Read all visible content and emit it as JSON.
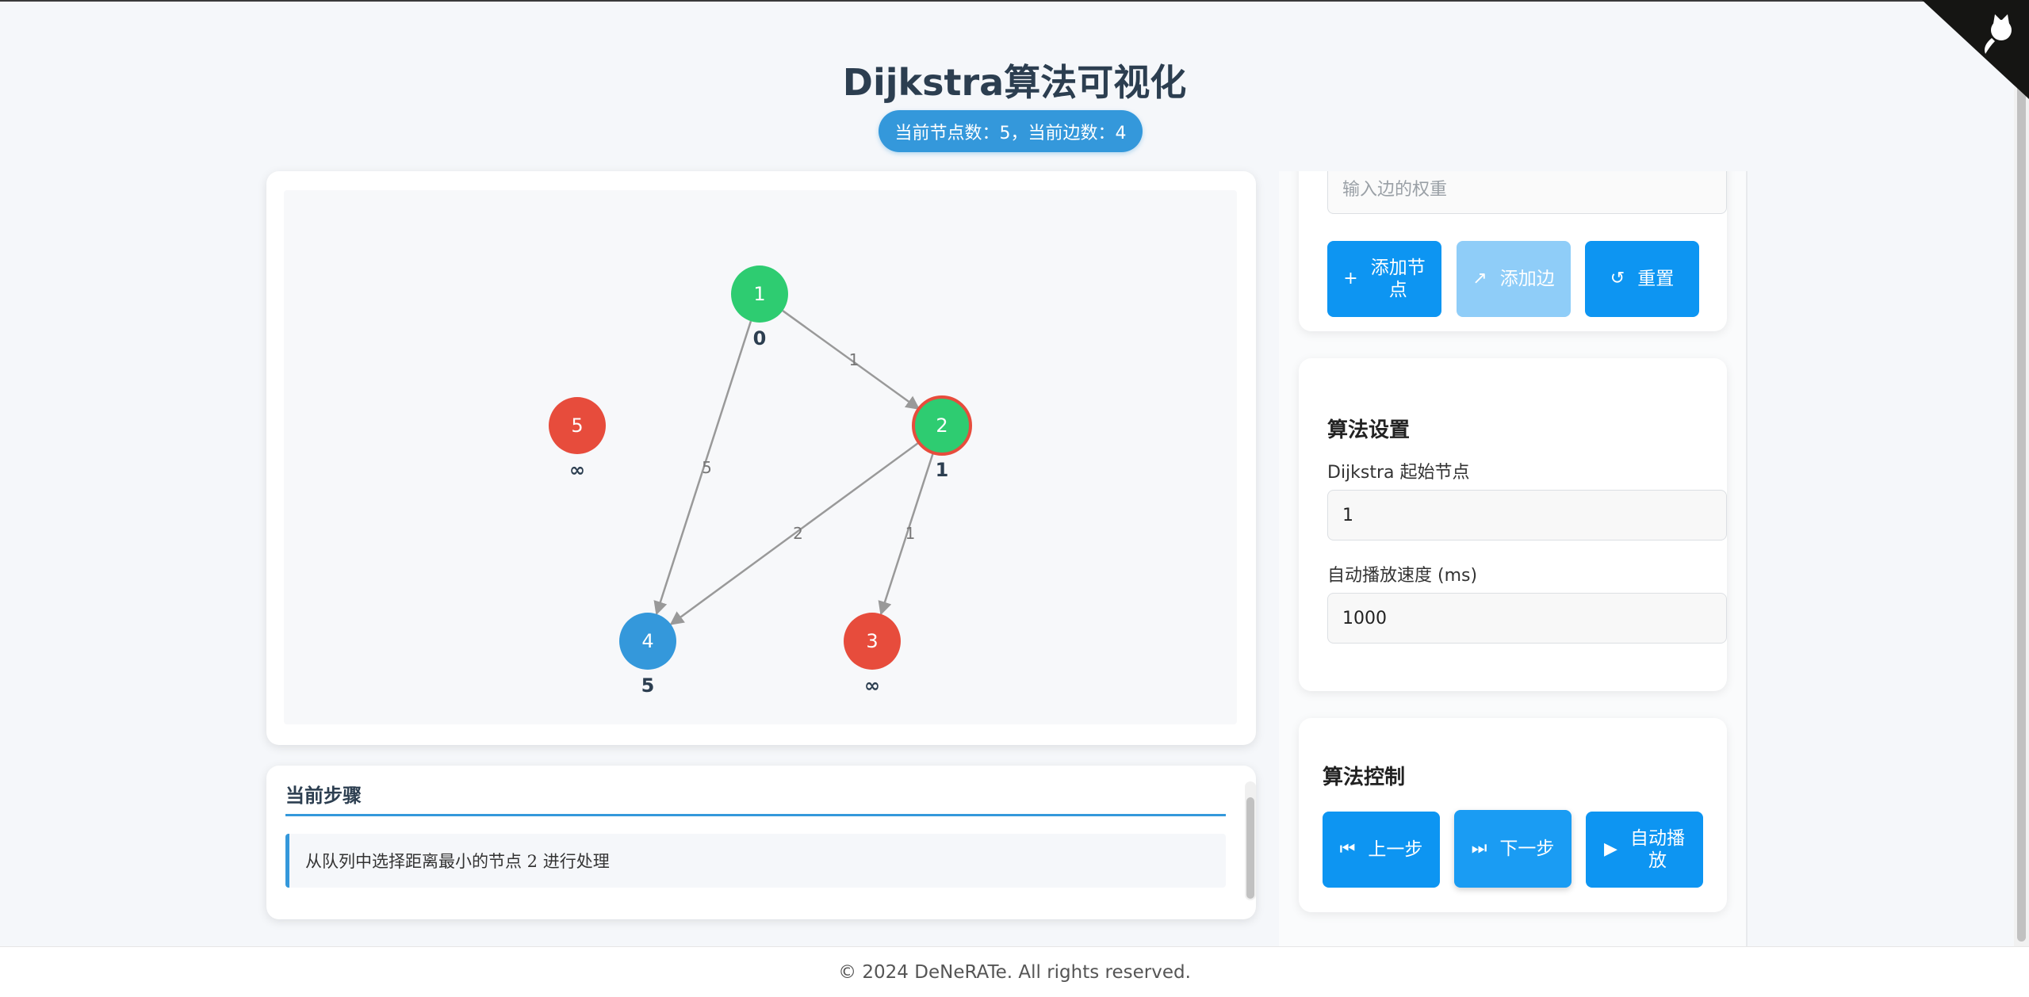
{
  "title": "Dijkstra算法可视化",
  "stats": "当前节点数：5，当前边数：4",
  "edge_form": {
    "weight_placeholder": "输入边的权重",
    "add_node_label": "添加节\n点",
    "add_edge_label": "添加边",
    "reset_label": "重置"
  },
  "algo_settings": {
    "title": "算法设置",
    "start_label": "Dijkstra 起始节点",
    "start_value": "1",
    "speed_label": "自动播放速度 (ms)",
    "speed_value": "1000"
  },
  "algo_control": {
    "title": "算法控制",
    "prev_label": "上一步",
    "next_label": "下一步",
    "auto_label": "自动播\n放"
  },
  "steps": {
    "title": "当前步骤",
    "current": "从队列中选择距离最小的节点 2 进行处理"
  },
  "footer": "© 2024 DeNeRATe. All rights reserved.",
  "graph": {
    "colors": {
      "visited": "#2ecc71",
      "unvisited": "#e74c3c",
      "queued": "#3498db",
      "edge": "#999999",
      "current_ring": "#e74c3c"
    },
    "nodes": [
      {
        "id": "1",
        "distance": "0",
        "state": "visited"
      },
      {
        "id": "2",
        "distance": "1",
        "state": "visited",
        "current": true
      },
      {
        "id": "3",
        "distance": "∞",
        "state": "unvisited"
      },
      {
        "id": "4",
        "distance": "5",
        "state": "queued"
      },
      {
        "id": "5",
        "distance": "∞",
        "state": "unvisited"
      }
    ],
    "edges": [
      {
        "from": "1",
        "to": "2",
        "weight": "1"
      },
      {
        "from": "1",
        "to": "4",
        "weight": "5"
      },
      {
        "from": "2",
        "to": "4",
        "weight": "2"
      },
      {
        "from": "2",
        "to": "3",
        "weight": "1"
      }
    ]
  },
  "icons": {
    "add_node": "plus-icon",
    "add_edge": "arrow-up-right-icon",
    "reset": "reset-icon",
    "prev": "skip-back-icon",
    "next": "skip-forward-icon",
    "auto": "play-icon",
    "corner": "github-corner-icon"
  }
}
